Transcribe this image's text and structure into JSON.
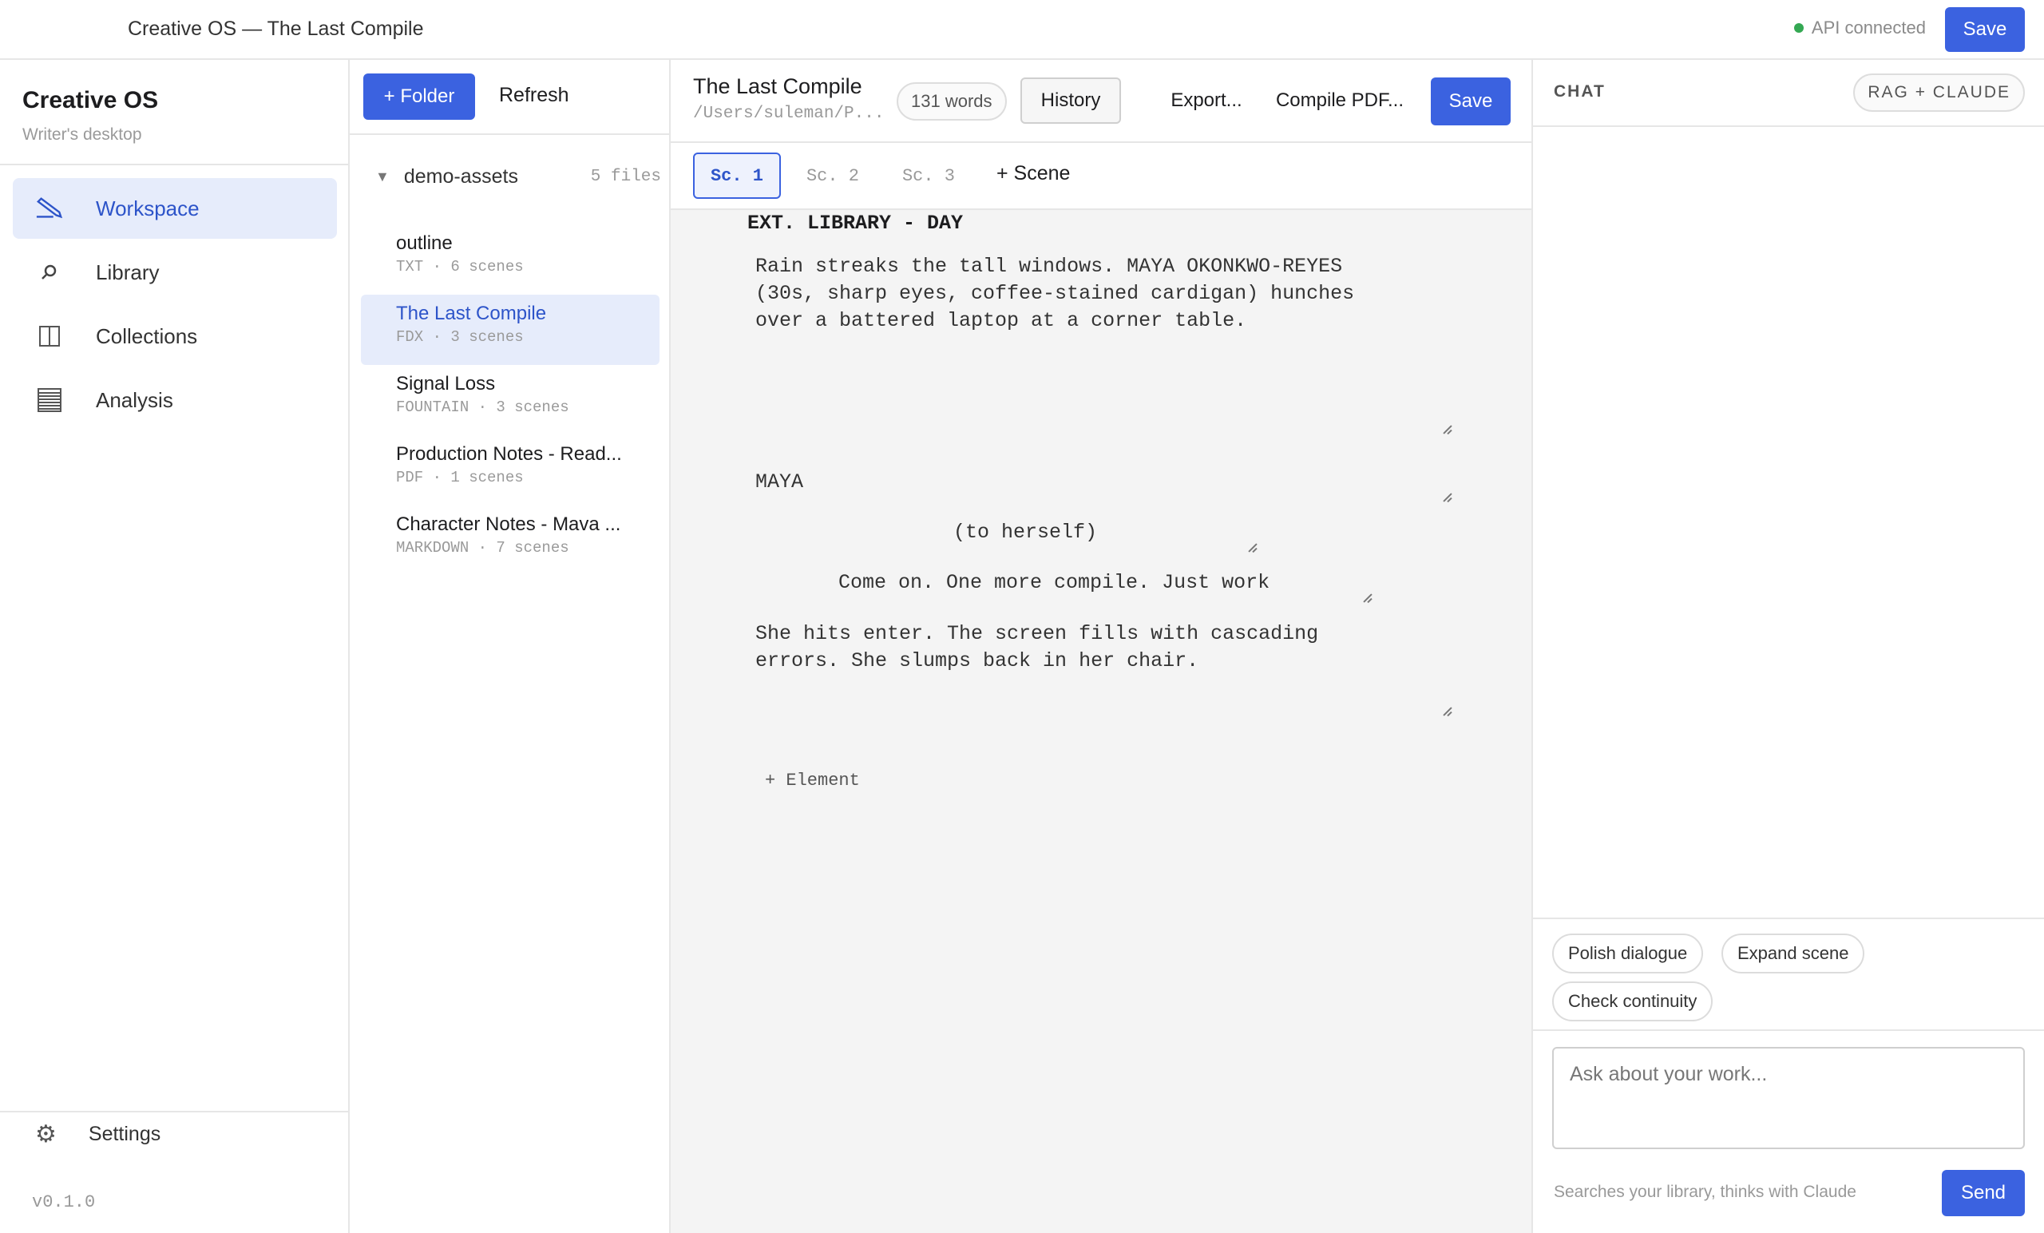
{
  "topbar": {
    "title": "Creative OS — The Last Compile",
    "api_status": "API connected",
    "save_label": "Save"
  },
  "sidebar": {
    "brand": "Creative OS",
    "subtitle": "Writer's desktop",
    "items": [
      {
        "label": "Workspace",
        "icon": "pencil-icon",
        "active": true
      },
      {
        "label": "Library",
        "icon": "search-icon",
        "active": false
      },
      {
        "label": "Collections",
        "icon": "columns-icon",
        "active": false
      },
      {
        "label": "Analysis",
        "icon": "table-icon",
        "active": false
      }
    ],
    "settings_label": "Settings",
    "version": "v0.1.0"
  },
  "files": {
    "add_folder_label": "+ Folder",
    "refresh_label": "Refresh",
    "folder_name": "demo-assets",
    "folder_count": "5 files",
    "items": [
      {
        "name": "outline",
        "meta": "TXT · 6 scenes"
      },
      {
        "name": "The Last Compile",
        "meta": "FDX · 3 scenes"
      },
      {
        "name": "Signal Loss",
        "meta": "FOUNTAIN · 3 scenes"
      },
      {
        "name": "Production Notes - Read...",
        "meta": "PDF · 1 scenes"
      },
      {
        "name": "Character Notes - Mava ...",
        "meta": "MARKDOWN · 7 scenes"
      }
    ]
  },
  "editor": {
    "title": "The Last Compile",
    "path": "/Users/suleman/P...",
    "word_count": "131 words",
    "history_label": "History",
    "export_label": "Export...",
    "compile_label": "Compile PDF...",
    "save_label": "Save",
    "scene_tabs": [
      "Sc. 1",
      "Sc. 2",
      "Sc. 3"
    ],
    "add_scene_label": "+ Scene",
    "slugline": "EXT. LIBRARY - DAY",
    "action_1": "Rain streaks the tall windows. MAYA OKONKWO-REYES\n(30s, sharp eyes, coffee-stained cardigan) hunches\nover a battered laptop at a corner table.",
    "character": "MAYA",
    "parenthetical": "(to herself)",
    "dialogue": "Come on. One more compile. Just work",
    "action_2": "She hits enter. The screen fills with cascading\nerrors. She slumps back in her chair.",
    "add_element_label": "+ Element"
  },
  "chat": {
    "label": "CHAT",
    "mode": "RAG + CLAUDE",
    "suggestions": [
      "Polish dialogue",
      "Expand scene",
      "Check continuity"
    ],
    "input_placeholder": "Ask about your work...",
    "hint": "Searches your library, thinks with Claude",
    "send_label": "Send"
  },
  "colors": {
    "accent": "#3b62e0",
    "active_bg": "#e6ecfb",
    "status_ok": "#34a853"
  }
}
